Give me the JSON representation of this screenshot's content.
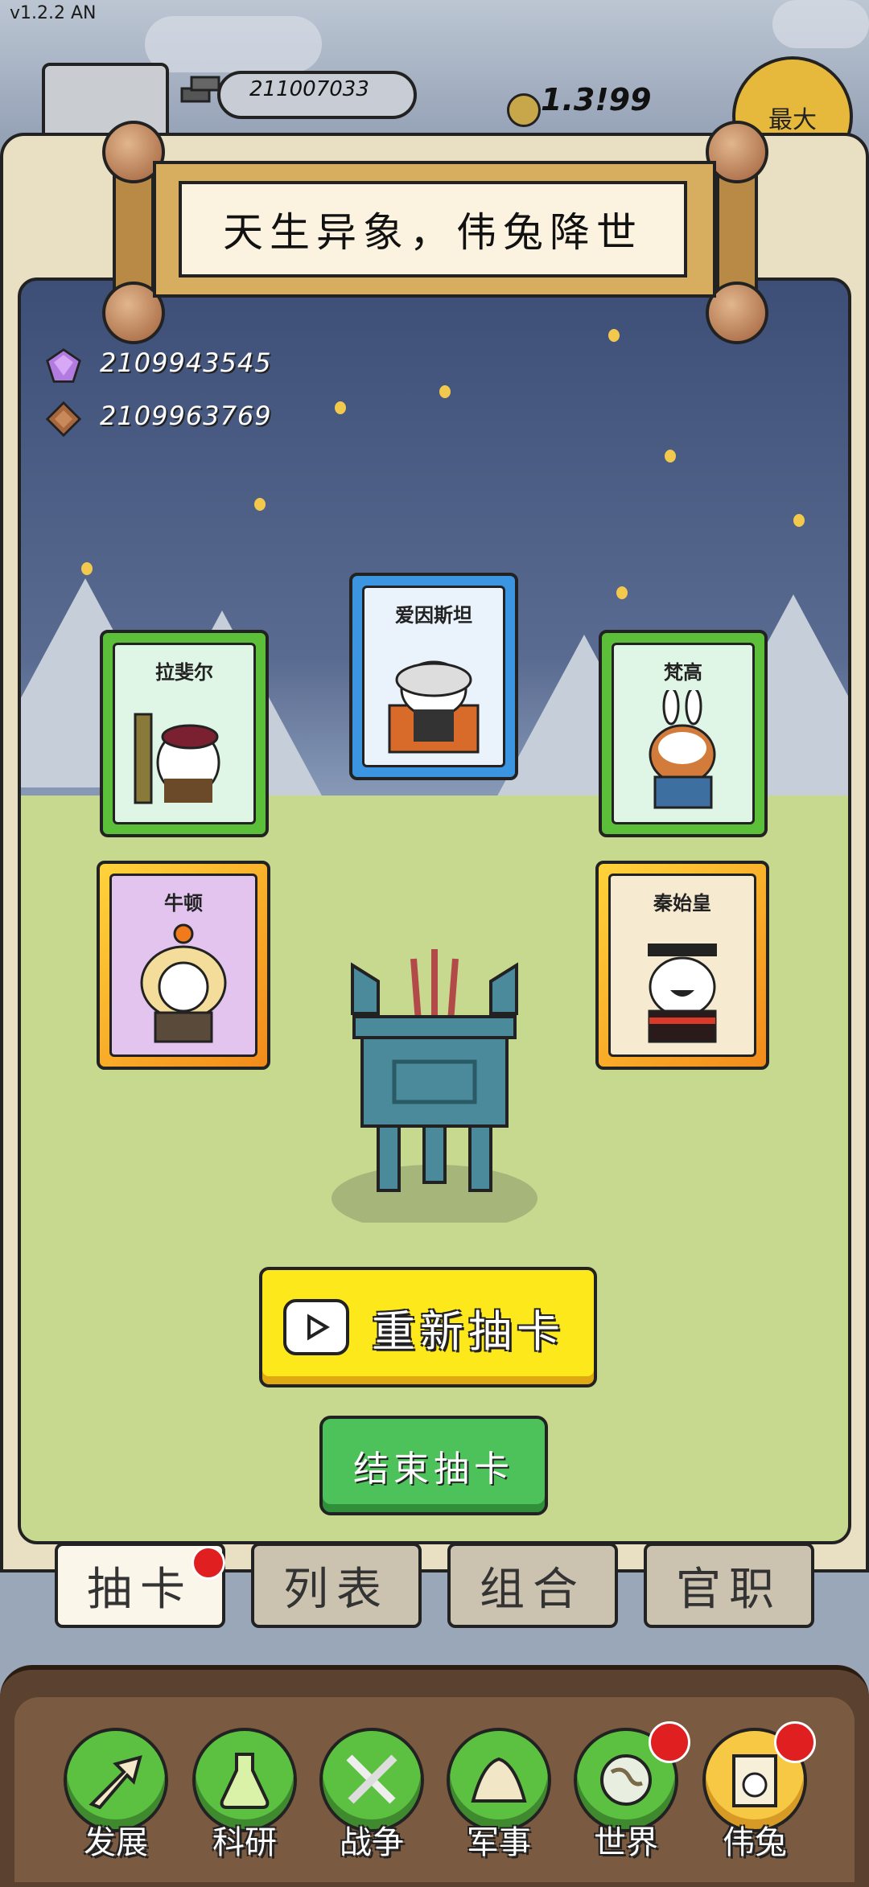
{
  "header": {
    "version": "v1.2.2 AN",
    "iron_value": "211007033",
    "gold_value": "1.3!99",
    "max_label": "最大"
  },
  "banner": {
    "title": "天生异象，伟兔降世"
  },
  "currencies": {
    "gem_value": "2109943545",
    "chest_value": "2109963769"
  },
  "cards": [
    {
      "name": "爱因斯坦",
      "frame": "blue"
    },
    {
      "name": "拉斐尔",
      "frame": "green"
    },
    {
      "name": "梵高",
      "frame": "green"
    },
    {
      "name": "牛顿",
      "frame": "gold"
    },
    {
      "name": "秦始皇",
      "frame": "gold"
    }
  ],
  "actions": {
    "redraw_label": "重新抽卡",
    "end_label": "结束抽卡"
  },
  "subtabs": [
    {
      "label": "抽卡",
      "active": true,
      "badge": true
    },
    {
      "label": "列表",
      "active": false,
      "badge": false
    },
    {
      "label": "组合",
      "active": false,
      "badge": false
    },
    {
      "label": "官职",
      "active": false,
      "badge": false
    }
  ],
  "nav": [
    {
      "label": "发展",
      "icon": "arrow-up-icon",
      "badge": false
    },
    {
      "label": "科研",
      "icon": "flask-icon",
      "badge": false
    },
    {
      "label": "战争",
      "icon": "crossed-swords-icon",
      "badge": false
    },
    {
      "label": "军事",
      "icon": "tent-icon",
      "badge": false
    },
    {
      "label": "世界",
      "icon": "globe-icon",
      "badge": true
    },
    {
      "label": "伟兔",
      "icon": "bunny-portrait-icon",
      "badge": true,
      "active": true
    }
  ],
  "colors": {
    "redraw_button": "#fde81b",
    "end_button": "#4ec25a",
    "nav_active": "#f7c843",
    "nav_default": "#5cc141",
    "badge": "#e02020"
  }
}
